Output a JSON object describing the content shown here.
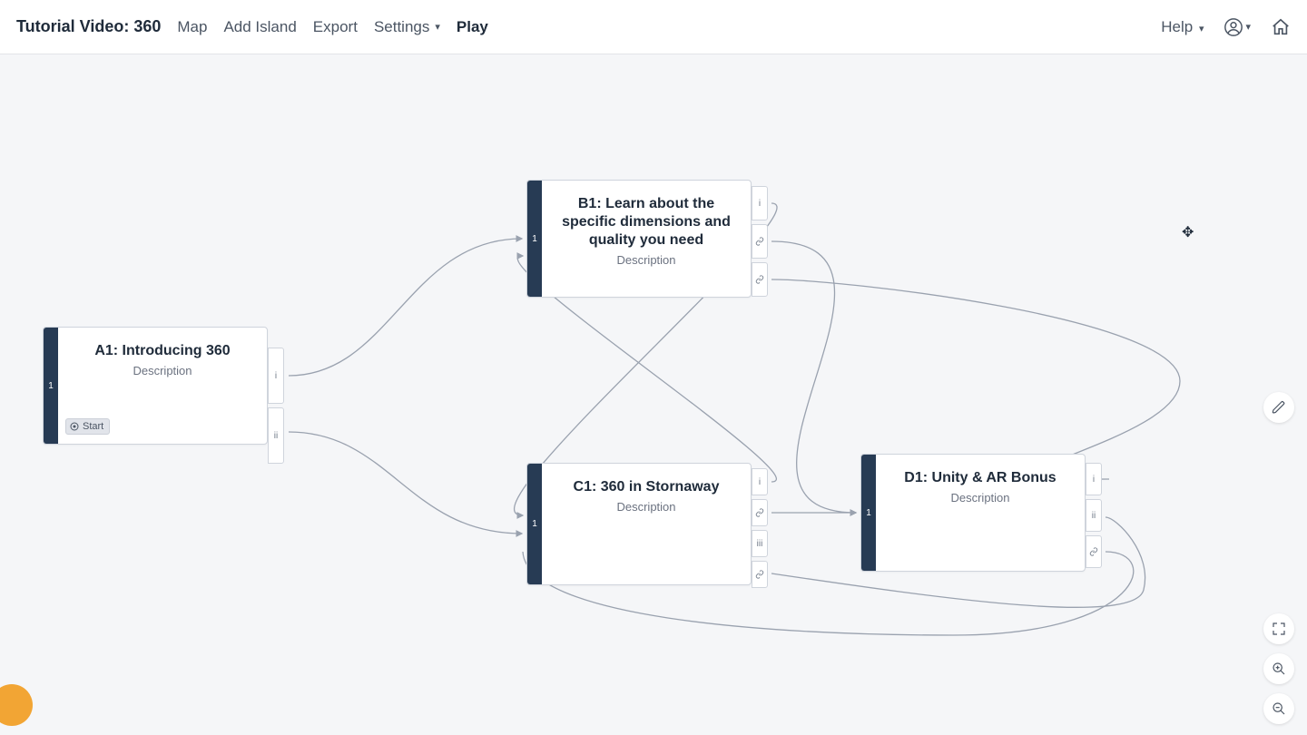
{
  "header": {
    "title": "Tutorial Video: 360",
    "menu": {
      "map": "Map",
      "add_island": "Add Island",
      "export": "Export",
      "settings": "Settings",
      "play": "Play"
    },
    "help": "Help"
  },
  "islands": {
    "a": {
      "title": "A1: Introducing 360",
      "desc": "Description",
      "badge_num": "1",
      "start_label": "Start",
      "tabs": [
        "i",
        "ii"
      ]
    },
    "b": {
      "title": "B1: Learn about the specific dimensions and quality you need",
      "desc": "Description",
      "badge_num": "1",
      "tabs": [
        "i",
        "link",
        "link"
      ]
    },
    "c": {
      "title": "C1: 360 in Stornaway",
      "desc": "Description",
      "badge_num": "1",
      "tabs": [
        "i",
        "link",
        "iii",
        "link"
      ]
    },
    "d": {
      "title": "D1: Unity & AR Bonus",
      "desc": "Description",
      "badge_num": "1",
      "tabs": [
        "i",
        "ii",
        "link"
      ]
    }
  },
  "colors": {
    "stripe": "#273b54",
    "canvas": "#f5f6f8",
    "accent_orange": "#f2a534"
  }
}
